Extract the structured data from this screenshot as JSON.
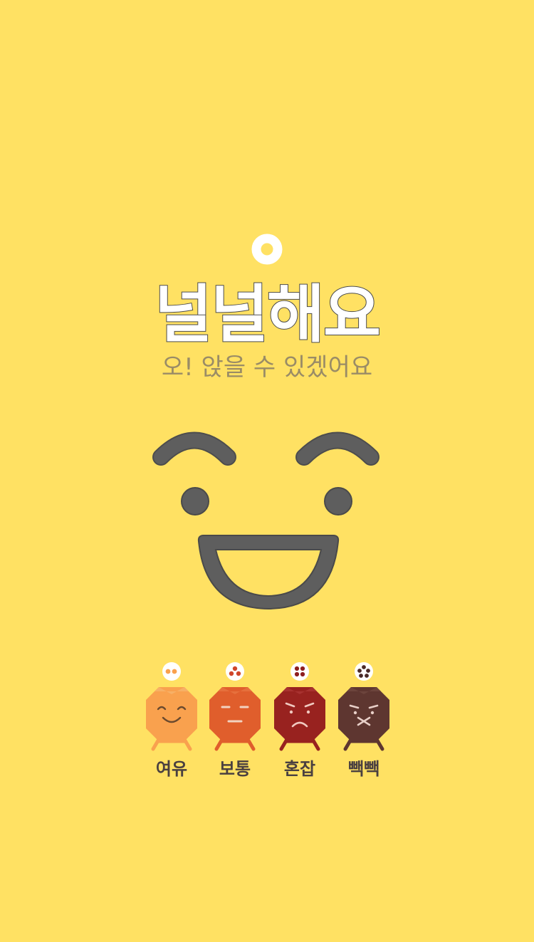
{
  "status": {
    "title": "널널해요",
    "subtitle": "오! 앉을 수 있겠어요",
    "indicator_icon": "ring-icon",
    "face_icon": "big-smiley-face-icon"
  },
  "legend": {
    "items": [
      {
        "label": "여유",
        "icon": "relaxed-face-icon",
        "color": "#F9A14E",
        "dots": 2,
        "dot_color": "#F9A14E"
      },
      {
        "label": "보통",
        "icon": "neutral-face-icon",
        "color": "#E05E2C",
        "dots": 3,
        "dot_color": "#D0462A"
      },
      {
        "label": "혼잡",
        "icon": "frown-face-icon",
        "color": "#98221F",
        "dots": 4,
        "dot_color": "#8E1F1F"
      },
      {
        "label": "빽빽",
        "icon": "crowded-face-icon",
        "color": "#5E3630",
        "dots": 5,
        "dot_color": "#4A2A28"
      }
    ]
  },
  "colors": {
    "background": "#FFE163",
    "face_stroke": "#5E5E5E",
    "ring": "#FFFFFF"
  }
}
